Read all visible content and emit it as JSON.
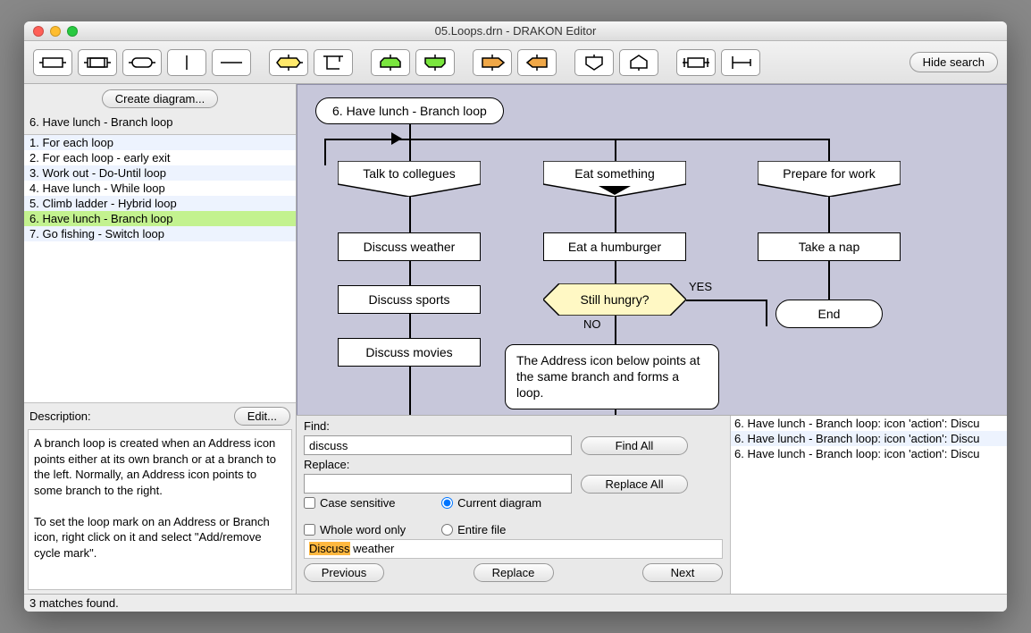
{
  "window": {
    "title": "05.Loops.drn - DRAKON Editor"
  },
  "toolbar": {
    "hide_search": "Hide search"
  },
  "sidebar": {
    "create_label": "Create diagram...",
    "filter": "6. Have lunch - Branch loop",
    "items": [
      "1. For each loop",
      "2. For each loop - early exit",
      "3. Work out - Do-Until loop",
      "4. Have lunch - While loop",
      "5. Climb ladder - Hybrid loop",
      "6. Have lunch - Branch loop",
      "7. Go fishing - Switch loop"
    ],
    "selected_index": 5,
    "description_label": "Description:",
    "edit_label": "Edit...",
    "description": "A branch loop is created when an Address icon points either at its own branch or at a branch to the left. Normally, an Address icon points to some branch to the right.\n\nTo set the loop mark on an Address or Branch icon, right click on it and select \"Add/remove cycle mark\"."
  },
  "diagram": {
    "header": "6. Have lunch - Branch loop",
    "branches": [
      "Talk to collegues",
      "Eat something",
      "Prepare for work"
    ],
    "col1": [
      "Discuss weather",
      "Discuss sports",
      "Discuss movies"
    ],
    "col2": {
      "action": "Eat a humburger",
      "question": "Still hungry?",
      "yes": "YES",
      "no": "NO"
    },
    "col3": {
      "action": "Take a nap",
      "end": "End"
    },
    "comment": "The Address icon below points\nat the same branch\nand forms a loop."
  },
  "find": {
    "find_label": "Find:",
    "find_value": "discuss",
    "replace_label": "Replace:",
    "replace_value": "",
    "find_all": "Find All",
    "replace_all": "Replace All",
    "case_sensitive": "Case sensitive",
    "whole_word": "Whole word only",
    "current_diagram": "Current diagram",
    "entire_file": "Entire file",
    "preview_hl": "Discuss",
    "preview_rest": " weather",
    "previous": "Previous",
    "replace": "Replace",
    "next": "Next"
  },
  "results": [
    "6. Have lunch - Branch loop: icon 'action': Discu",
    "6. Have lunch - Branch loop: icon 'action': Discu",
    "6. Have lunch - Branch loop: icon 'action': Discu"
  ],
  "status": "3 matches found."
}
